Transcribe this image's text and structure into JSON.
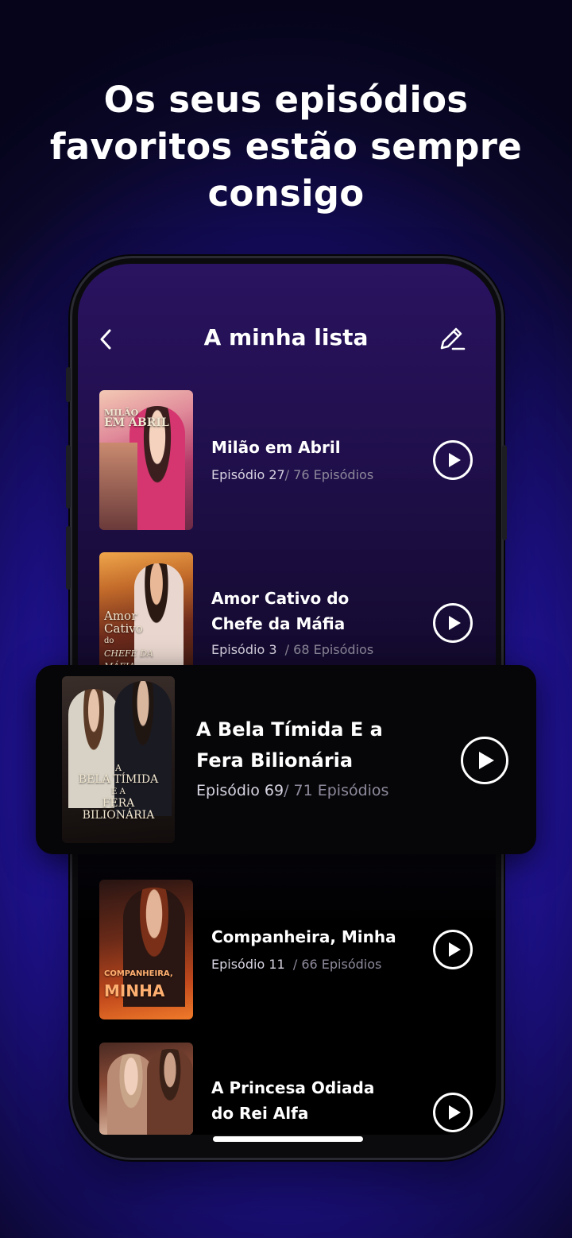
{
  "headline": {
    "line1": "Os seus episódios",
    "line2": "favoritos estão sempre",
    "line3": "consigo"
  },
  "nav": {
    "back_icon": "chevron-left-icon",
    "title": "A minha lista",
    "edit_icon": "edit-pencil-icon"
  },
  "list": [
    {
      "title": "Milão em Abril",
      "episode": "Episódio 27",
      "total": "/ 76 Episódios",
      "cover_text": [
        "MILÃO",
        "EM ABRIL"
      ]
    },
    {
      "title": "Amor Cativo do Chefe da Máfia",
      "episode": "Episódio 3",
      "total": "/ 68 Episódios",
      "cover_text": [
        "Amor",
        "Cativo",
        "do",
        "CHEFE DA",
        "MÁFIA"
      ]
    },
    {
      "title": "A Bela Tímida E a Fera Bilionária",
      "episode": "Episódio 69",
      "total": "/ 71 Episódios",
      "cover_text": [
        "A",
        "BELA TÍMIDA",
        "E A",
        "FERA",
        "BILIONÁRIA"
      ]
    },
    {
      "title": "Companheira, Minha",
      "episode": "Episódio 11",
      "total": "/ 66 Episódios",
      "cover_text": [
        "COMPANHEIRA,",
        "MINHA"
      ]
    },
    {
      "title": "A Princesa Odiada do Rei Alfa",
      "episode": "",
      "total": "",
      "cover_text": []
    }
  ],
  "colors": {
    "background_glow": "#3a1fe6",
    "background_dark": "#05041a",
    "screen_top": "#2a1360",
    "highlight_card": "#060608",
    "muted_text": "#8f8a9c"
  }
}
